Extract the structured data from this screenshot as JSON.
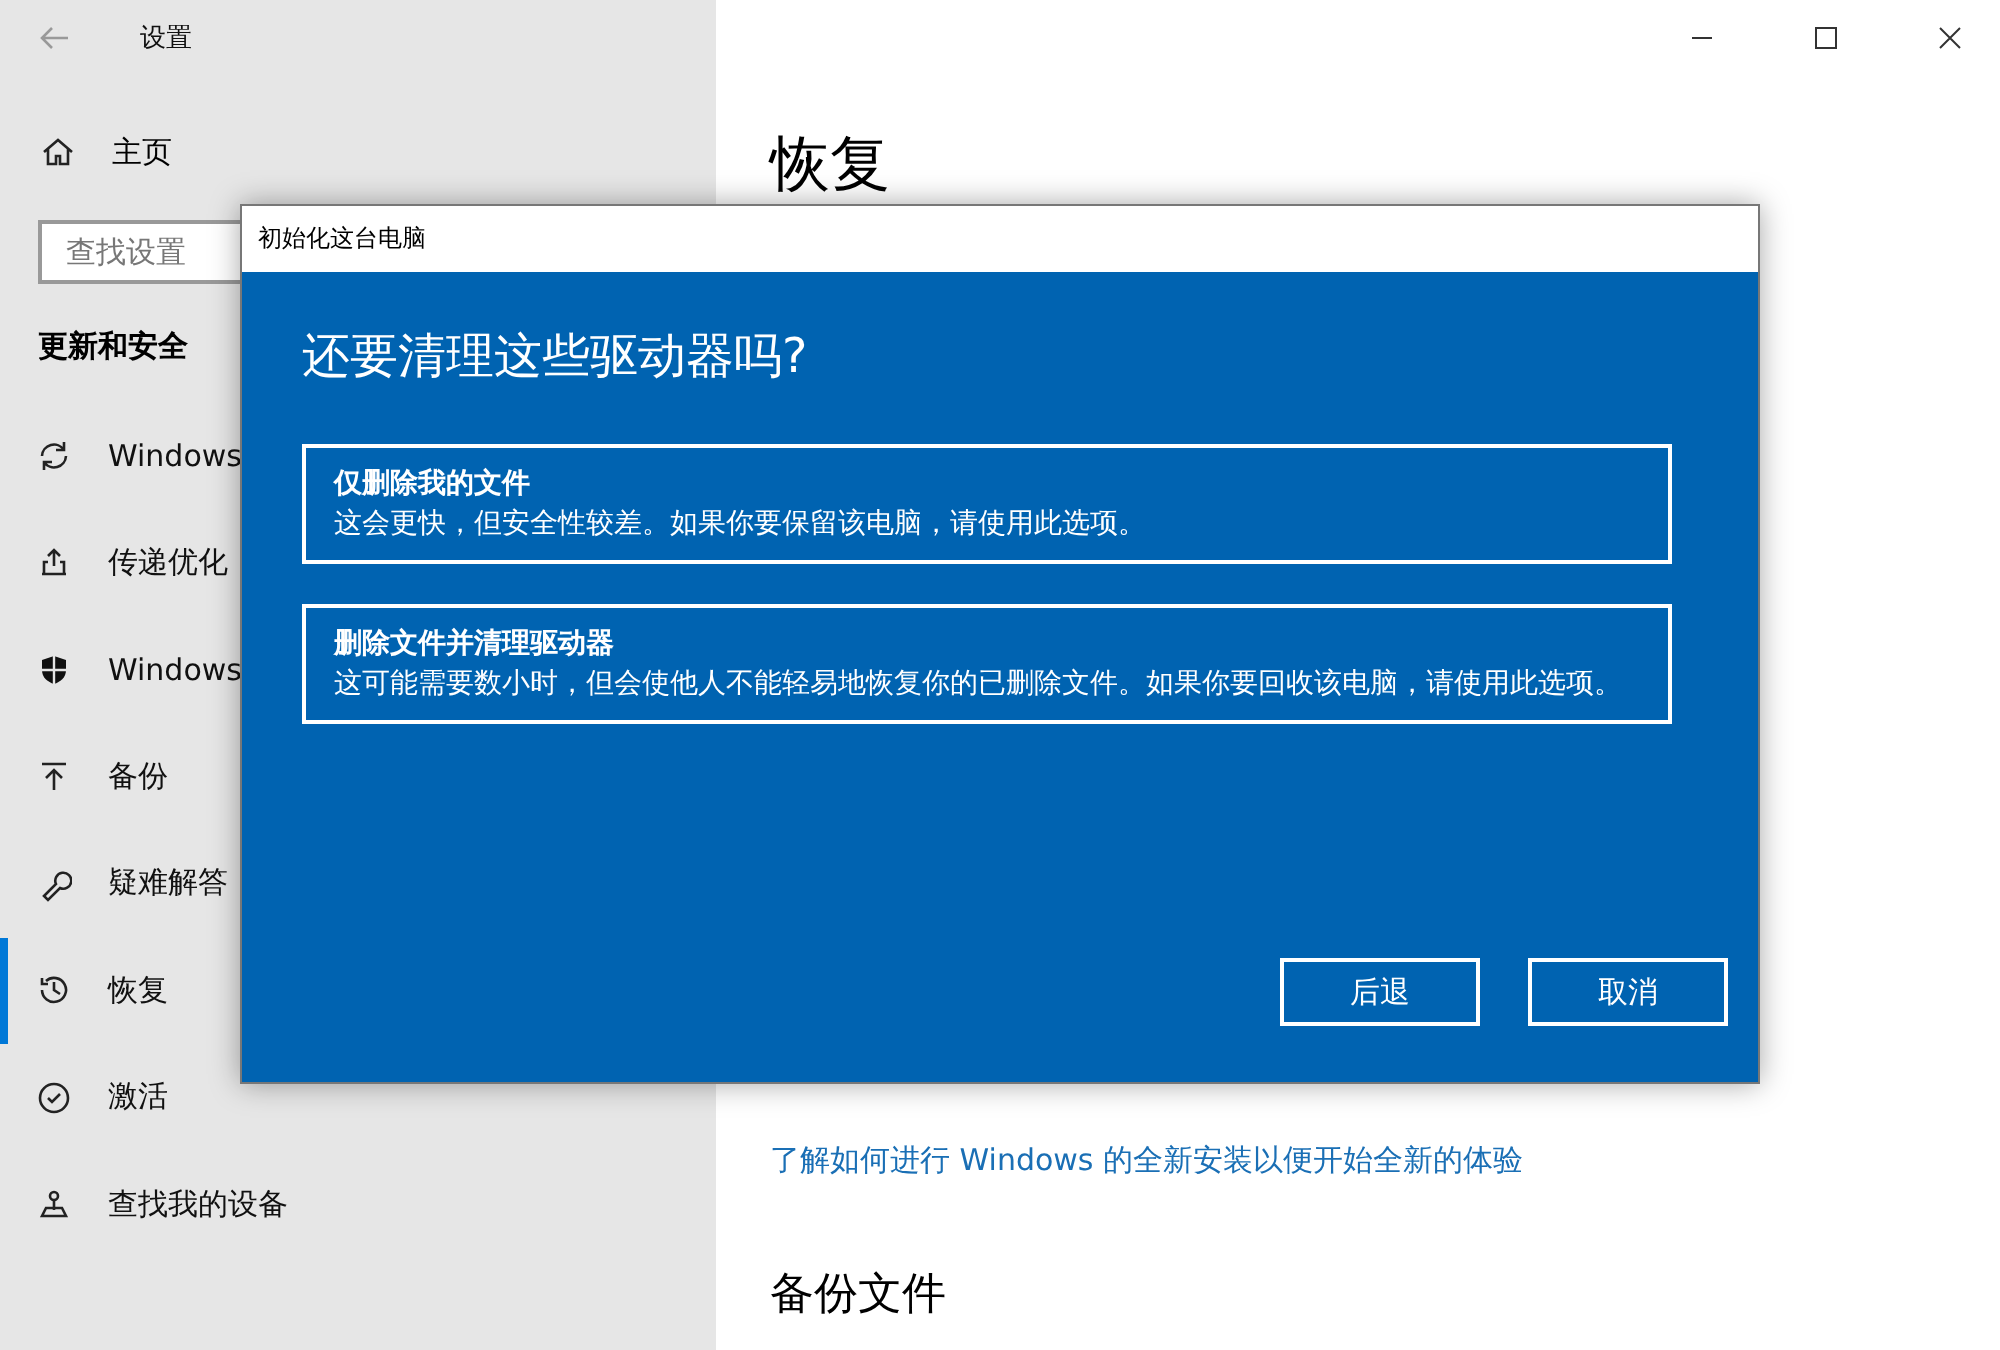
{
  "window": {
    "title": "设置"
  },
  "sidebar": {
    "home": "主页",
    "search": {
      "placeholder": "查找设置"
    },
    "section": "更新和安全",
    "items": [
      {
        "label": "Windows",
        "selected": false
      },
      {
        "label": "传递优化",
        "selected": false
      },
      {
        "label": "Windows",
        "selected": false
      },
      {
        "label": "备份",
        "selected": false
      },
      {
        "label": "疑难解答",
        "selected": false
      },
      {
        "label": "恢复",
        "selected": true
      },
      {
        "label": "激活",
        "selected": false
      },
      {
        "label": "查找我的设备",
        "selected": false
      }
    ]
  },
  "main": {
    "title": "恢复",
    "link": "了解如何进行 Windows 的全新安装以便开始全新的体验",
    "section": "备份文件"
  },
  "dialog": {
    "title": "初始化这台电脑",
    "heading": "还要清理这些驱动器吗?",
    "options": [
      {
        "title": "仅删除我的文件",
        "description": "这会更快，但安全性较差。如果你要保留该电脑，请使用此选项。"
      },
      {
        "title": "删除文件并清理驱动器",
        "description": "这可能需要数小时，但会使他人不能轻易地恢复你的已删除文件。如果你要回收该电脑，请使用此选项。"
      }
    ],
    "buttons": [
      "后退",
      "取消"
    ]
  }
}
